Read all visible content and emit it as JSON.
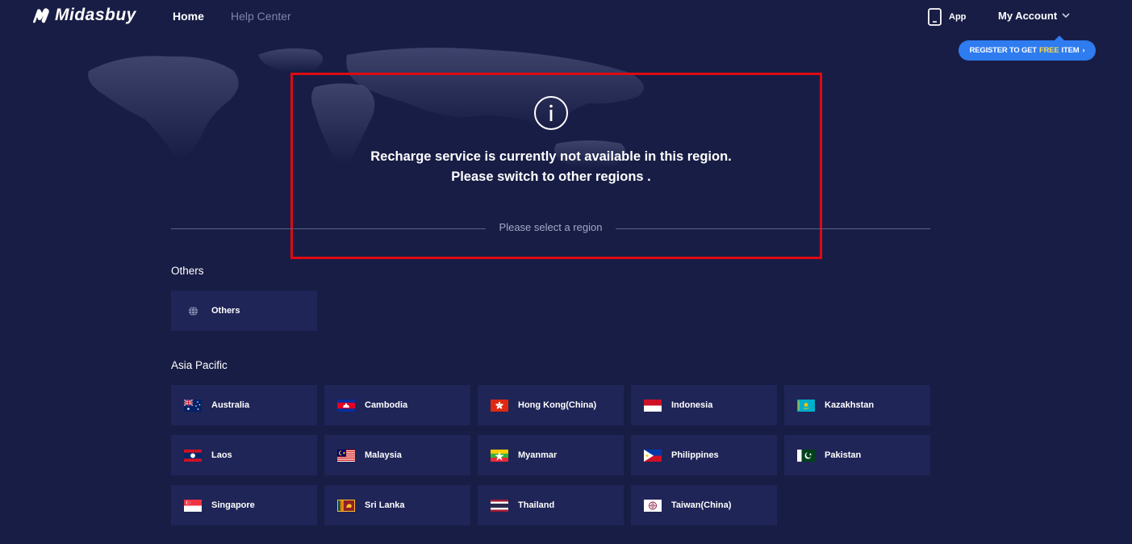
{
  "header": {
    "brand": "Midasbuy",
    "nav": [
      {
        "label": "Home",
        "active": true
      },
      {
        "label": "Help Center",
        "active": false
      }
    ],
    "app_label": "App",
    "account_label": "My Account",
    "promo": {
      "prefix": "REGISTER TO GET",
      "highlight": "FREE",
      "suffix": "ITEM",
      "arrow": "›"
    }
  },
  "notice": {
    "icon": "info-icon",
    "line1": "Recharge service is currently not available in this region.",
    "line2": "Please switch to other regions ."
  },
  "region_divider": "Please select a region",
  "sections": [
    {
      "title": "Others",
      "regions": [
        {
          "name": "Others",
          "icon": "globe-icon"
        }
      ]
    },
    {
      "title": "Asia Pacific",
      "regions": [
        {
          "name": "Australia",
          "icon": "flag-australia-icon"
        },
        {
          "name": "Cambodia",
          "icon": "flag-cambodia-icon"
        },
        {
          "name": "Hong Kong(China)",
          "icon": "flag-hong-kong-icon"
        },
        {
          "name": "Indonesia",
          "icon": "flag-indonesia-icon"
        },
        {
          "name": "Kazakhstan",
          "icon": "flag-kazakhstan-icon"
        },
        {
          "name": "Laos",
          "icon": "flag-laos-icon"
        },
        {
          "name": "Malaysia",
          "icon": "flag-malaysia-icon"
        },
        {
          "name": "Myanmar",
          "icon": "flag-myanmar-icon"
        },
        {
          "name": "Philippines",
          "icon": "flag-philippines-icon"
        },
        {
          "name": "Pakistan",
          "icon": "flag-pakistan-icon"
        },
        {
          "name": "Singapore",
          "icon": "flag-singapore-icon"
        },
        {
          "name": "Sri Lanka",
          "icon": "flag-sri-lanka-icon"
        },
        {
          "name": "Thailand",
          "icon": "flag-thailand-icon"
        },
        {
          "name": "Taiwan(China)",
          "icon": "flag-taiwan-icon"
        }
      ]
    }
  ],
  "colors": {
    "background": "#181d45",
    "tile": "#1f2557",
    "promo": "#2e7cf0",
    "promo_highlight": "#ffd94a",
    "highlight_box": "#dd0a14",
    "muted_text": "#7e84a8"
  }
}
